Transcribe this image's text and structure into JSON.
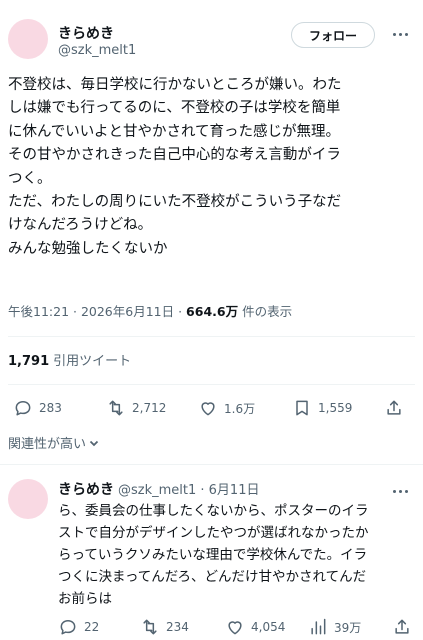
{
  "post": {
    "author_name": "きらめき",
    "author_handle": "@szk_melt1",
    "follow_label": "フォロー",
    "text": "不登校は、毎日学校に行かないところが嫌い。わた\nしは嫌でも行ってるのに、不登校の子は学校を簡単\nに休んでいいよと甘やかされて育った感じが無理。\nその甘やかされきった自己中心的な考え言動がイラ\nつく。\nただ、わたしの周りにいた不登校がこういう子なだ\nけなんだろうけどね。\nみんな勉強したくないか",
    "timestamp": "午後11:21 · 2026年6月11日 · ",
    "views_count": "664.6万",
    "views_label": " 件の表示",
    "quote_count": "1,791",
    "quote_label": "引用ツイート",
    "replies": "283",
    "reposts": "2,712",
    "likes": "1.6万",
    "bookmarks": "1,559"
  },
  "relevance_label": "関連性が高い",
  "reply": {
    "author_name": "きらめき",
    "author_handle_date": "@szk_melt1 · 6月11日",
    "text": "ら、委員会の仕事したくないから、ポスターのイラ\nストで自分がデザインしたやつが選ばれなかったか\nらっていうクソみたいな理由で学校休んでた。イラ\nつくに決まってんだろ、どんだけ甘やかされてんだ\nお前らは",
    "replies": "22",
    "reposts": "234",
    "likes": "4,054",
    "views": "39万"
  },
  "colors": {
    "avatar": "#f9d9e3",
    "secondary_text": "#536471",
    "divider": "#eff3f4"
  }
}
